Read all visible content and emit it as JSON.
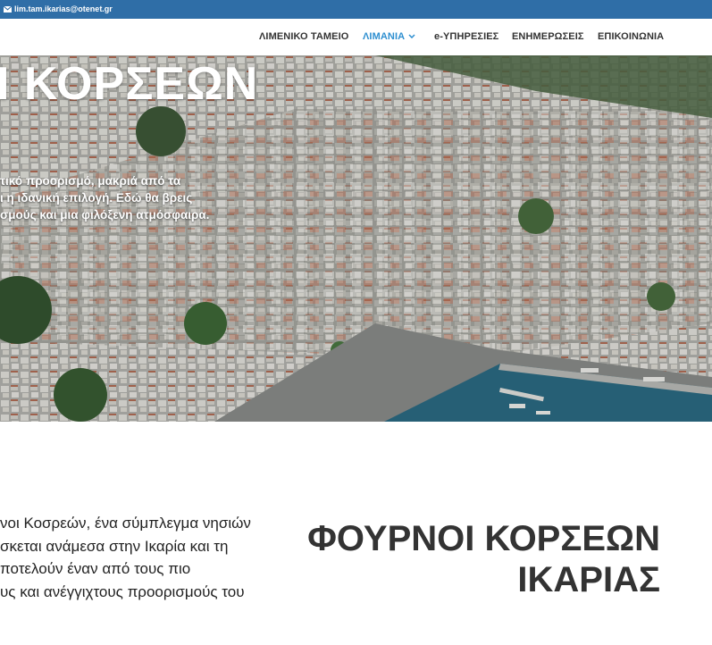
{
  "topbar": {
    "email": "lim.tam.ikarias@otenet.gr",
    "email_icon": "envelope-icon"
  },
  "nav": {
    "items": [
      {
        "label": "ΛΙΜΕΝΙΚΟ ΤΑΜΕΙΟ",
        "active": false
      },
      {
        "label": "ΛΙΜΑΝΙΑ",
        "active": true,
        "dropdown_icon": "chevron-down-icon"
      },
      {
        "label": "e-ΥΠΗΡΕΣΙΕΣ",
        "active": false
      },
      {
        "label": "ΕΝΗΜΕΡΩΣΕΙΣ",
        "active": false
      },
      {
        "label": "ΕΠΙΚΟΙΝΩΝΙΑ",
        "active": false
      }
    ],
    "active_color": "#2e8fd0"
  },
  "hero": {
    "title": "Ι ΚΟΡΣΕΩΝ",
    "lines": [
      "τικό προορισμό, μακριά από τα",
      "ι η ιδανική επιλογή. Εδώ θα βρεις",
      "σμούς και μια φιλόξενη ατμόσφαιρα."
    ]
  },
  "intro": {
    "lines": [
      "νοι Κοσρεών, ένα σύμπλεγμα νησιών",
      "σκεται ανάμεσα στην Ικαρία και τη",
      "ποτελούν έναν από τους πιο",
      "υς και ανέγγιχτους προορισμούς του"
    ]
  },
  "heading": {
    "line1": "ΦΟΥΡΝΟΙ ΚΟΡΣΕΩΝ",
    "line2": "ΙΚΑΡΙΑΣ"
  },
  "colors": {
    "topbar": "#2f6ea7",
    "heading": "#333333"
  }
}
